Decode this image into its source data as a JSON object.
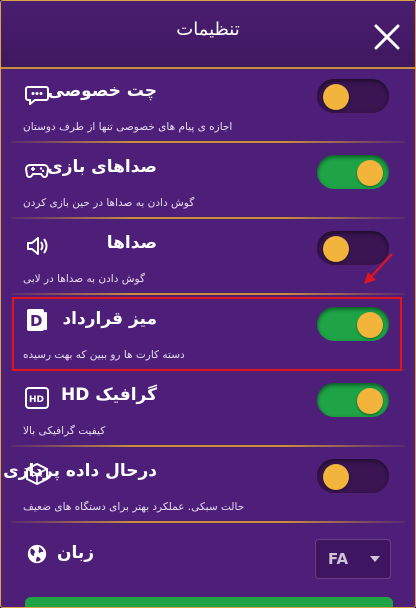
{
  "header": {
    "title": "تنظیمات"
  },
  "settings": [
    {
      "label": "چت خصوصی",
      "desc": "اجازه ی پیام های خصوصی تنها از طرف دوستان",
      "state": "off",
      "icon": "chat-bubble-icon"
    },
    {
      "label": "صداهای بازی",
      "desc": "گوش دادن به صداها در حین بازی کردن",
      "state": "on",
      "icon": "gamepad-icon"
    },
    {
      "label": "صداها",
      "desc": "گوش دادن به صداها در لابی",
      "state": "off",
      "icon": "speaker-icon"
    },
    {
      "label": "میز قرارداد",
      "desc": "دسته کارت ها رو ببین که بهت رسیده",
      "state": "on",
      "icon": "card-deck-icon"
    },
    {
      "label": "گرافیک HD",
      "desc": "کیفیت گرافیکی بالا",
      "state": "on",
      "icon": "hd-icon"
    },
    {
      "label": "درحال داده پردازی",
      "desc": "حالت سبکی. عملکرد بهتر برای دستگاه های ضعیف",
      "state": "off",
      "icon": "cube-icon"
    }
  ],
  "language": {
    "label": "زبان",
    "value": "FA",
    "icon": "globe-icon"
  },
  "colors": {
    "toggle_on": "#1ea447",
    "toggle_off": "#3a1552",
    "knob": "#f2b43a",
    "accent_border": "#c88f3a",
    "highlight": "#e0141e"
  }
}
